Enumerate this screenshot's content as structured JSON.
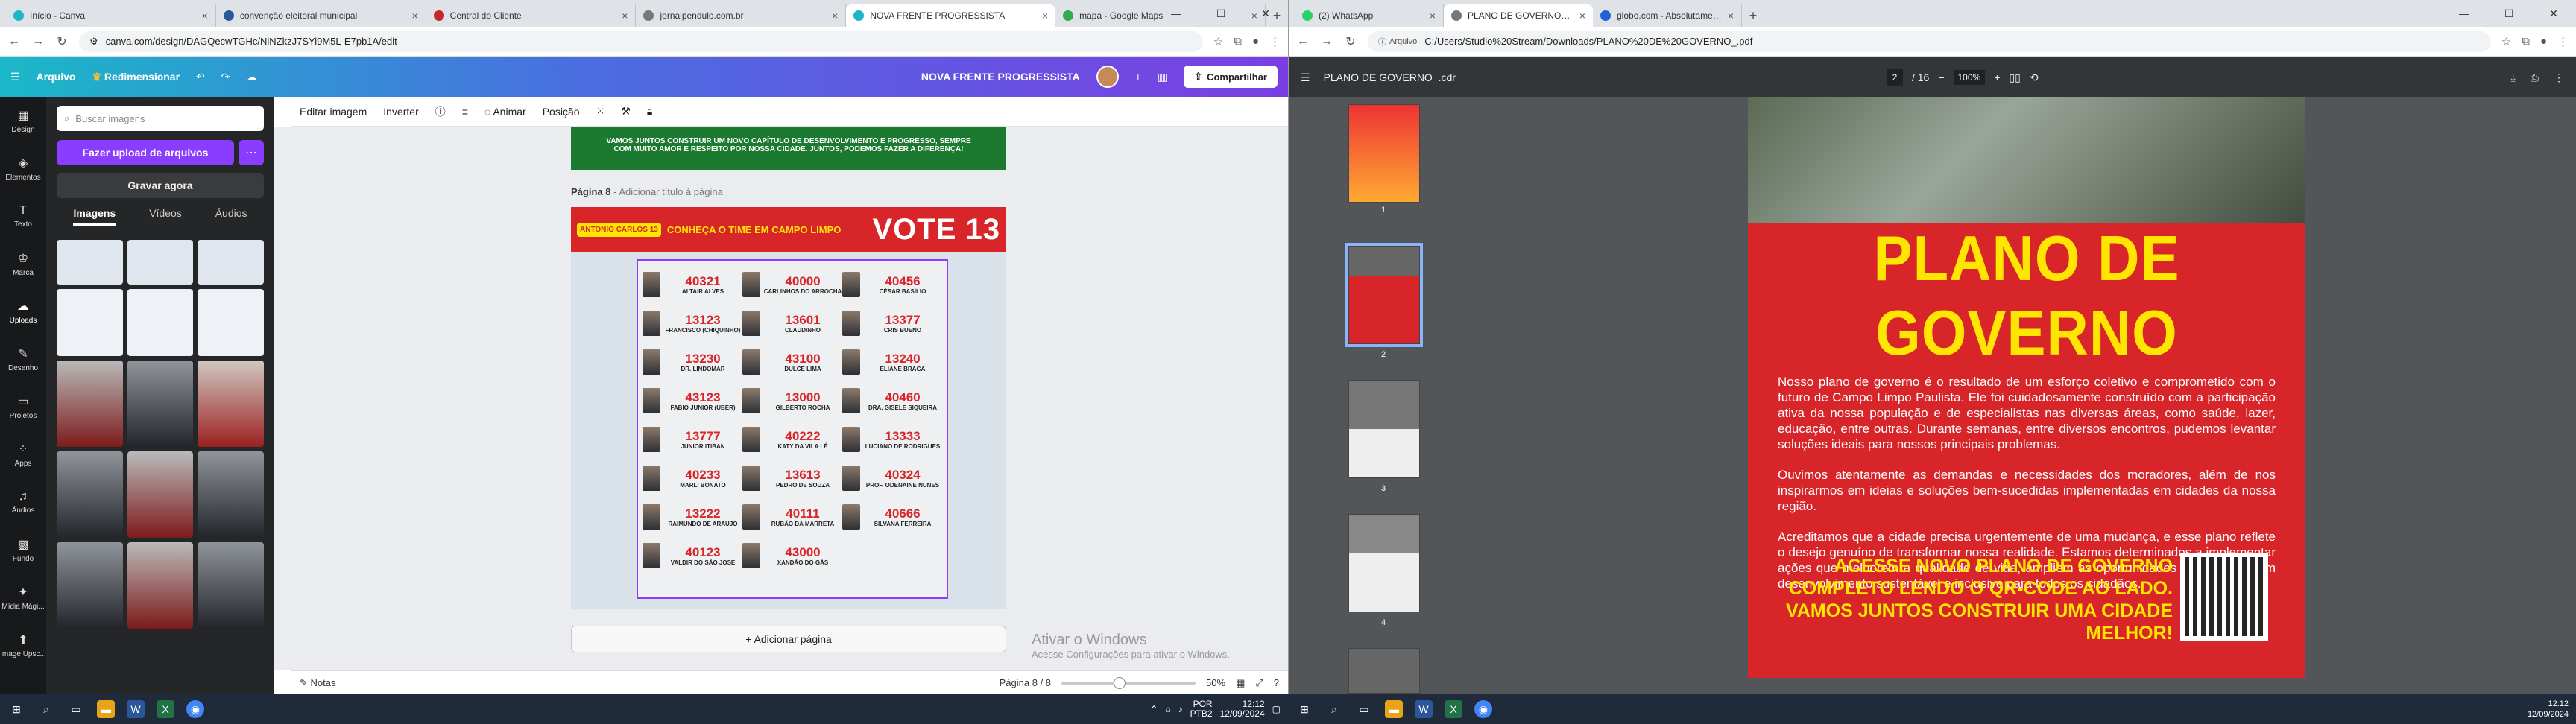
{
  "left_browser": {
    "tabs": [
      {
        "title": "Início - Canva",
        "color": "#1eb6c6"
      },
      {
        "title": "convenção eleitoral municipal",
        "color": "#2b579a"
      },
      {
        "title": "Central do Cliente",
        "color": "#c62828"
      },
      {
        "title": "jornalpendulo.com.br",
        "color": "#777777"
      },
      {
        "title": "NOVA FRENTE PROGRESSISTA",
        "color": "#1eb6c6",
        "active": true
      },
      {
        "title": "mapa - Google Maps",
        "color": "#34a853"
      }
    ],
    "url": "canva.com/design/DAGQecwTGHc/NiNZkzJ7SYi9M5L-E7pb1A/edit"
  },
  "canva": {
    "top": {
      "file": "Arquivo",
      "resize": "Redimensionar",
      "title": "NOVA FRENTE PROGRESSISTA",
      "share": "Compartilhar"
    },
    "rail": [
      "Design",
      "Elementos",
      "Texto",
      "Marca",
      "Uploads",
      "Desenho",
      "Projetos",
      "Apps",
      "Áudios",
      "Fundo",
      "Mídia Mági...",
      "Image Upsc..."
    ],
    "panel": {
      "search_placeholder": "Buscar imagens",
      "upload": "Fazer upload de arquivos",
      "record": "Gravar agora",
      "tabs": [
        "Imagens",
        "Vídeos",
        "Áudios"
      ]
    },
    "toolbar": {
      "edit_image": "Editar imagem",
      "flip": "Inverter",
      "animate": "Animar",
      "position": "Posição"
    },
    "prev_page_text": "VAMOS JUNTOS CONSTRUIR UM NOVO CAPÍTULO DE DESENVOLVIMENTO E PROGRESSO, SEMPRE COM MUITO AMOR E RESPEITO POR NOSSA CIDADE. JUNTOS, PODEMOS FAZER A DIFERENÇA!",
    "page_label": "Página 8",
    "page_title_placeholder": "- Adicionar título à página",
    "design": {
      "badge": "ANTONIO CARLOS 13",
      "header": "CONHEÇA O TIME EM CAMPO LIMPO",
      "vote": "VOTE 13"
    },
    "candidates": [
      {
        "num": "40321",
        "name": "ALTAIR ALVES"
      },
      {
        "num": "40000",
        "name": "CARLINHOS DO ARROCHA"
      },
      {
        "num": "40456",
        "name": "CÉSAR BASÍLIO"
      },
      {
        "num": "13123",
        "name": "FRANCISCO (CHIQUINHO)"
      },
      {
        "num": "13601",
        "name": "CLAUDINHO"
      },
      {
        "num": "13377",
        "name": "CRIS BUENO"
      },
      {
        "num": "13230",
        "name": "DR. LINDOMAR"
      },
      {
        "num": "43100",
        "name": "DULCE LIMA"
      },
      {
        "num": "13240",
        "name": "ELIANE BRAGA"
      },
      {
        "num": "43123",
        "name": "FABIO JUNIOR (UBER)"
      },
      {
        "num": "13000",
        "name": "GILBERTO ROCHA"
      },
      {
        "num": "40460",
        "name": "DRA. GISELE SIQUEIRA"
      },
      {
        "num": "13777",
        "name": "JUNIOR ITIBAN"
      },
      {
        "num": "40222",
        "name": "KATY DA VILA LÉ"
      },
      {
        "num": "13333",
        "name": "LUCIANO DE RODRIGUES"
      },
      {
        "num": "40233",
        "name": "MARLI BONATO"
      },
      {
        "num": "13613",
        "name": "PEDRO DE SOUZA"
      },
      {
        "num": "40324",
        "name": "PROF. ODENAINE NUNES"
      },
      {
        "num": "13222",
        "name": "RAIMUNDO DE ARAUJO"
      },
      {
        "num": "40111",
        "name": "RUBÃO DA MARRETA"
      },
      {
        "num": "40666",
        "name": "SILVANA FERREIRA"
      },
      {
        "num": "40123",
        "name": "VALDIR DO SÃO JOSÉ"
      },
      {
        "num": "43000",
        "name": "XANDÃO DO GÁS"
      }
    ],
    "add_page": "+ Adicionar página",
    "watermark_title": "Ativar o Windows",
    "watermark_sub": "Acesse Configurações para ativar o Windows.",
    "bottom": {
      "notes": "Notas",
      "page_counter": "Página 8 / 8",
      "zoom": "50%"
    }
  },
  "right_browser": {
    "tabs": [
      {
        "title": "(2) WhatsApp",
        "color": "#25d366"
      },
      {
        "title": "PLANO DE GOVERNO_.cdr",
        "color": "#777777",
        "active": true
      },
      {
        "title": "globo.com - Absolutamente t...",
        "color": "#1e63d4"
      }
    ],
    "url_badge": "Arquivo",
    "url": "C:/Users/Studio%20Stream/Downloads/PLANO%20DE%20GOVERNO_.pdf"
  },
  "pdf": {
    "title": "PLANO DE GOVERNO_.cdr",
    "page": "2",
    "total": "/ 16",
    "zoom": "100%",
    "thumb_numbers": [
      "1",
      "2",
      "3",
      "4"
    ],
    "page_title": "PLANO DE GOVERNO",
    "paragraphs": [
      "Nosso plano de governo é o resultado de um esforço coletivo e comprometido com o futuro de Campo Limpo Paulista. Ele foi cuidadosamente construído com a participação ativa da nossa população e de especialistas nas diversas áreas, como saúde, lazer, educação, entre outras. Durante semanas, entre diversos encontros, pudemos levantar soluções ideais para nossos principais problemas.",
      "Ouvimos atentamente as demandas e necessidades dos moradores, além de nos inspirarmos em ideias e soluções bem-sucedidas implementadas em cidades da nossa região.",
      "Acreditamos que a cidade precisa urgentemente de uma mudança, e esse plano reflete o desejo genuíno de transformar nossa realidade. Estamos determinados a implementar ações que melhorem a qualidade de vida, ampliem as oportunidades e promovam um desenvolvimento sustentável e inclusivo para todos os cidadãos."
    ],
    "cta": "ACESSE NOVO PLANO DE GOVERNO COMPLETO LENDO O QR-CODE AO LADO. VAMOS JUNTOS CONSTRUIR UMA CIDADE MELHOR!"
  },
  "taskbar_left": {
    "lang": "POR",
    "kbd": "PTB2",
    "time": "12:12",
    "date": "12/09/2024"
  },
  "taskbar_right": {
    "time": "12:12",
    "date": "12/09/2024"
  }
}
